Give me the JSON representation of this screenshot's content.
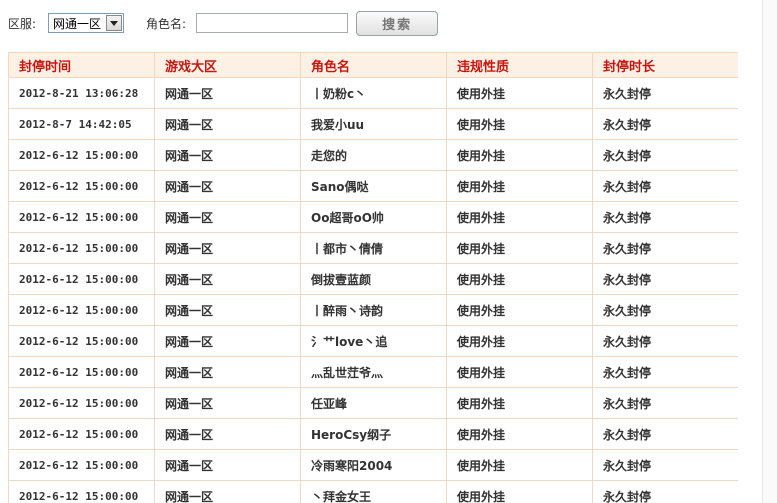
{
  "filter": {
    "server_label": "区服:",
    "server_selected": "网通一区",
    "name_label": "角色名:",
    "name_value": "",
    "search_label": "搜索"
  },
  "table": {
    "headers": [
      "封停时间",
      "游戏大区",
      "角色名",
      "违规性质",
      "封停时长"
    ],
    "rows": [
      [
        "2012-8-21 13:06:28",
        "网通一区",
        "丨奶粉c丶",
        "使用外挂",
        "永久封停"
      ],
      [
        "2012-8-7 14:42:05",
        "网通一区",
        "我爱小uu",
        "使用外挂",
        "永久封停"
      ],
      [
        "2012-6-12 15:00:00",
        "网通一区",
        "走您的",
        "使用外挂",
        "永久封停"
      ],
      [
        "2012-6-12 15:00:00",
        "网通一区",
        "Sano偶哒",
        "使用外挂",
        "永久封停"
      ],
      [
        "2012-6-12 15:00:00",
        "网通一区",
        "Oo超哥oO帅",
        "使用外挂",
        "永久封停"
      ],
      [
        "2012-6-12 15:00:00",
        "网通一区",
        "丨都市丶倩倩",
        "使用外挂",
        "永久封停"
      ],
      [
        "2012-6-12 15:00:00",
        "网通一区",
        "倒拔壹蓝颜",
        "使用外挂",
        "永久封停"
      ],
      [
        "2012-6-12 15:00:00",
        "网通一区",
        "丨醉雨丶诗韵",
        "使用外挂",
        "永久封停"
      ],
      [
        "2012-6-12 15:00:00",
        "网通一区",
        "氵艹love丶追",
        "使用外挂",
        "永久封停"
      ],
      [
        "2012-6-12 15:00:00",
        "网通一区",
        "灬乱世茳爷灬",
        "使用外挂",
        "永久封停"
      ],
      [
        "2012-6-12 15:00:00",
        "网通一区",
        "任亚峰",
        "使用外挂",
        "永久封停"
      ],
      [
        "2012-6-12 15:00:00",
        "网通一区",
        "HeroCsy纲子",
        "使用外挂",
        "永久封停"
      ],
      [
        "2012-6-12 15:00:00",
        "网通一区",
        "冷雨寒阳2004",
        "使用外挂",
        "永久封停"
      ],
      [
        "2012-6-12 15:00:00",
        "网通一区",
        "丶拜金女王",
        "使用外挂",
        "永久封停"
      ]
    ]
  }
}
